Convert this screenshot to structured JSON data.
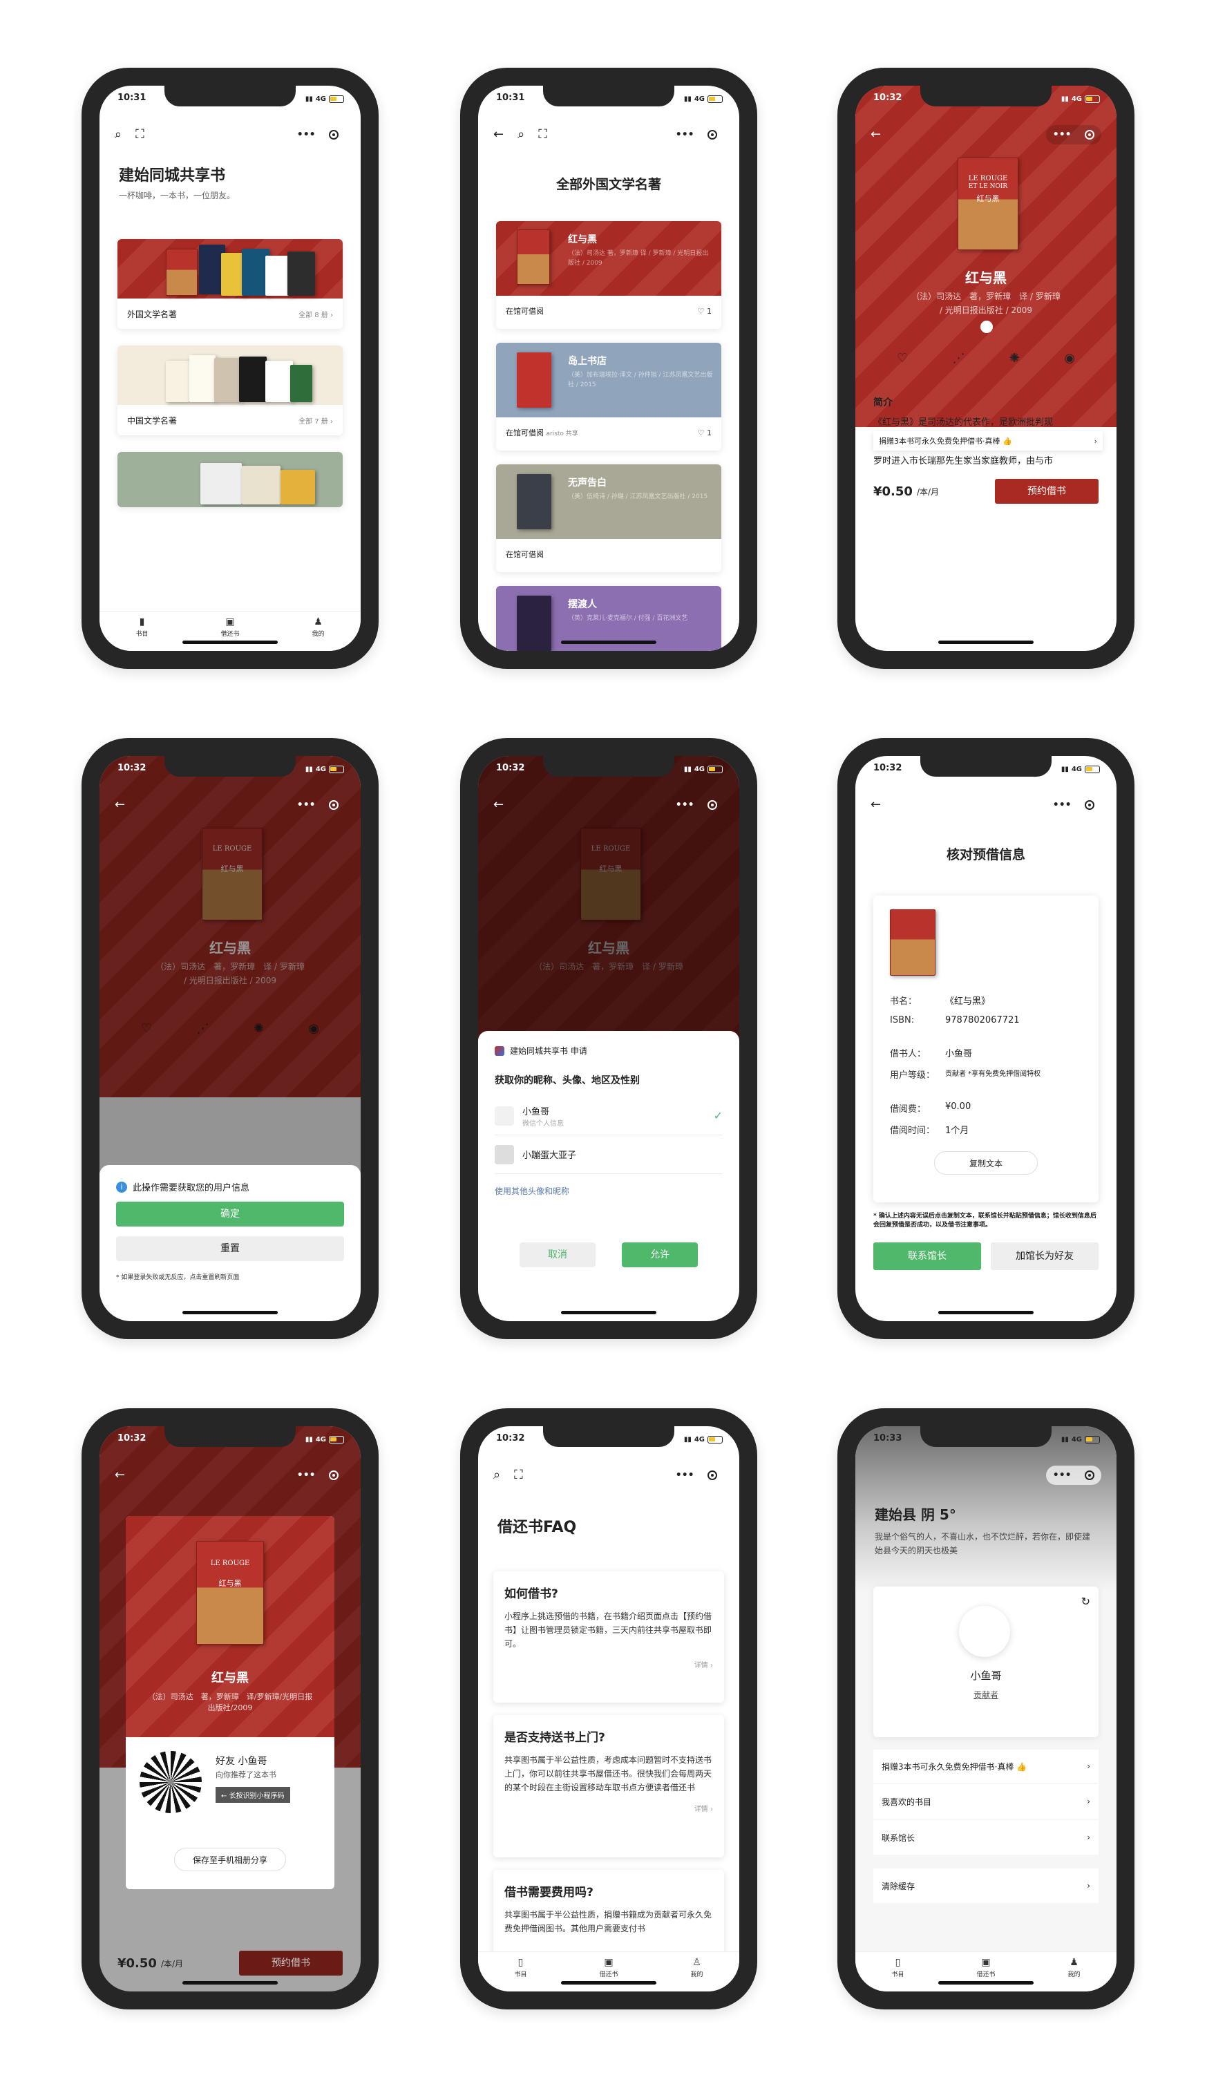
{
  "status": {
    "t1": "10:31",
    "t2": "10:32",
    "t3": "10:33",
    "net": "4G"
  },
  "s1": {
    "title": "建始同城共享书",
    "subtitle": "一杯咖啡，一本书，一位朋友。",
    "cards": [
      {
        "label": "外国文学名著",
        "count": "全部 8 册"
      },
      {
        "label": "中国文学名著",
        "count": "全部 7 册"
      }
    ],
    "tabs": [
      "书目",
      "借还书",
      "我的"
    ]
  },
  "s2": {
    "title": "全部外国文学名著",
    "books": [
      {
        "title": "红与黑",
        "meta": "（法）司汤达 著，罗新璋 译 / 罗新璋 / 光明日报出版社 / 2009",
        "status": "在馆可借阅",
        "likes": "1",
        "owner": ""
      },
      {
        "title": "岛上书店",
        "meta": "（美）加布瑞埃拉·泽文 / 孙仲旭 / 江苏凤凰文艺出版社 / 2015",
        "status": "在馆可借阅",
        "likes": "1",
        "owner": "aristo 共享"
      },
      {
        "title": "无声告白",
        "meta": "（美）伍绮诗 / 孙璐 / 江苏凤凰文艺出版社 / 2015",
        "status": "在馆可借阅",
        "likes": "",
        "owner": ""
      },
      {
        "title": "摆渡人",
        "meta": "（英）克莱儿·麦克福尔 / 付强 / 百花洲文艺",
        "status": "",
        "likes": "",
        "owner": ""
      }
    ]
  },
  "s3": {
    "cover_en1": "LE ROUGE",
    "cover_en2": "ET LE NOIR",
    "cover_cn": "红与黑",
    "book_title": "红与黑",
    "meta1": "（法）司汤达　著，罗新璋　译 / 罗新璋",
    "meta2": "/ 光明日报出版社 / 2009",
    "intro_label": "简介",
    "intro_text": "《红与黑》是司汤达的代表作，是欧洲批判现",
    "intro_text2": "罗时进入市长瑞那先生家当家庭教师，由与市",
    "banner": "捐赠3本书可永久免费免押借书·真棒 👍",
    "price": "¥0.50",
    "unit": "/本/月",
    "reserve": "预约借书"
  },
  "s4": {
    "notice": "此操作需要获取您的用户信息",
    "confirm": "确定",
    "reset": "重置",
    "tip": "* 如果登录失败或无反应，点击重置刷新页面"
  },
  "s5": {
    "app": "建始同城共享书 申请",
    "ask": "获取你的昵称、头像、地区及性别",
    "acc1": "小鱼哥",
    "acc1_sub": "微信个人信息",
    "acc2": "小蹦蛋大亚子",
    "other": "使用其他头像和昵称",
    "cancel": "取消",
    "allow": "允许"
  },
  "s6": {
    "title": "核对预借信息",
    "rows": [
      {
        "k": "书名：",
        "v": "《红与黑》"
      },
      {
        "k": "ISBN:",
        "v": "9787802067721"
      },
      {
        "k": "借书人：",
        "v": "小鱼哥"
      },
      {
        "k": "用户等级：",
        "v": "贡献者 *享有免费免押借阅特权"
      },
      {
        "k": "借阅费：",
        "v": "¥0.00"
      },
      {
        "k": "借阅时间：",
        "v": "1个月"
      }
    ],
    "copy": "复制文本",
    "note": "* 确认上述内容无误后点击复制文本，联系馆长并粘贴预借信息；馆长收到信息后会回复预借是否成功，以及借书注意事项。",
    "contact": "联系馆长",
    "add": "加馆长为好友"
  },
  "s7": {
    "book_title": "红与黑",
    "meta": "（法）司汤达　著，罗新璋　译/罗新璋/光明日报出版社/2009",
    "friend": "好友 小鱼哥",
    "rec": "向你推荐了这本书",
    "scan": "← 长按识别小程序码",
    "save": "保存至手机相册分享"
  },
  "s8": {
    "title": "借还书FAQ",
    "faqs": [
      {
        "q": "如何借书?",
        "a": "小程序上挑选预借的书籍，在书籍介绍页面点击【预约借书】让图书管理员锁定书籍，三天内前往共享书屋取书即可。",
        "d": "详情"
      },
      {
        "q": "是否支持送书上门?",
        "a": "共享图书属于半公益性质，考虑成本问题暂时不支持送书上门，你可以前往共享书屋借还书。很快我们会每周两天的某个时段在主街设置移动车取书点方便读者借还书",
        "d": "详情"
      },
      {
        "q": "借书需要费用吗?",
        "a": "共享图书属于半公益性质，捐赠书籍成为贡献者可永久免费免押借阅图书。其他用户需要支付书",
        "d": ""
      }
    ]
  },
  "s9": {
    "weather": "建始县 阴 5°",
    "quote": "我是个俗气的人，不喜山水，也不饮烂醉，若你在，即使建始县今天的阴天也极美",
    "name": "小鱼哥",
    "level": "贡献者",
    "items": [
      "捐赠3本书可永久免费免押借书·真棒 👍",
      "我喜欢的书目",
      "联系馆长",
      "清除缓存"
    ]
  }
}
